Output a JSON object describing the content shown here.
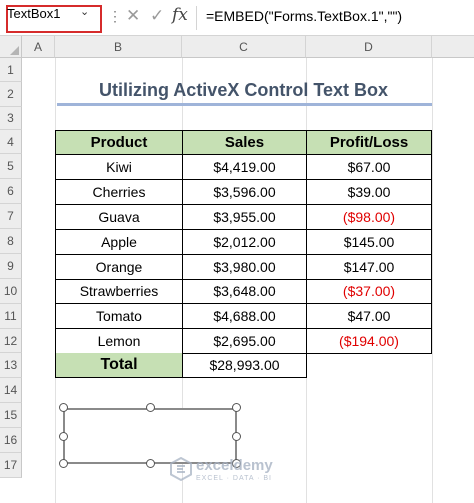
{
  "formula_bar": {
    "name_box": "TextBox1",
    "formula": "=EMBED(\"Forms.TextBox.1\",\"\")",
    "fx_label": "fx"
  },
  "columns": [
    "A",
    "B",
    "C",
    "D"
  ],
  "rows": [
    "1",
    "2",
    "3",
    "4",
    "5",
    "6",
    "7",
    "8",
    "9",
    "10",
    "11",
    "12",
    "13",
    "14",
    "15",
    "16",
    "17"
  ],
  "title": "Utilizing ActiveX Control Text Box",
  "table": {
    "headers": [
      "Product",
      "Sales",
      "Profit/Loss"
    ],
    "rows": [
      {
        "product": "Kiwi",
        "sales": "$4,419.00",
        "profit": "$67.00",
        "negative": false
      },
      {
        "product": "Cherries",
        "sales": "$3,596.00",
        "profit": "$39.00",
        "negative": false
      },
      {
        "product": "Guava",
        "sales": "$3,955.00",
        "profit": "($98.00)",
        "negative": true
      },
      {
        "product": "Apple",
        "sales": "$2,012.00",
        "profit": "$145.00",
        "negative": false
      },
      {
        "product": "Orange",
        "sales": "$3,980.00",
        "profit": "$147.00",
        "negative": false
      },
      {
        "product": "Strawberries",
        "sales": "$3,648.00",
        "profit": "($37.00)",
        "negative": true
      },
      {
        "product": "Tomato",
        "sales": "$4,688.00",
        "profit": "$47.00",
        "negative": false
      },
      {
        "product": "Lemon",
        "sales": "$2,695.00",
        "profit": "($194.00)",
        "negative": true
      }
    ],
    "total_label": "Total",
    "total_value": "$28,993.00"
  },
  "watermark": {
    "name": "exceldemy",
    "tagline": "EXCEL · DATA · BI"
  },
  "colors": {
    "header_fill": "#c6e0b4",
    "negative_text": "#e00000",
    "title_text": "#44546a",
    "name_box_highlight": "#d62b2b"
  }
}
